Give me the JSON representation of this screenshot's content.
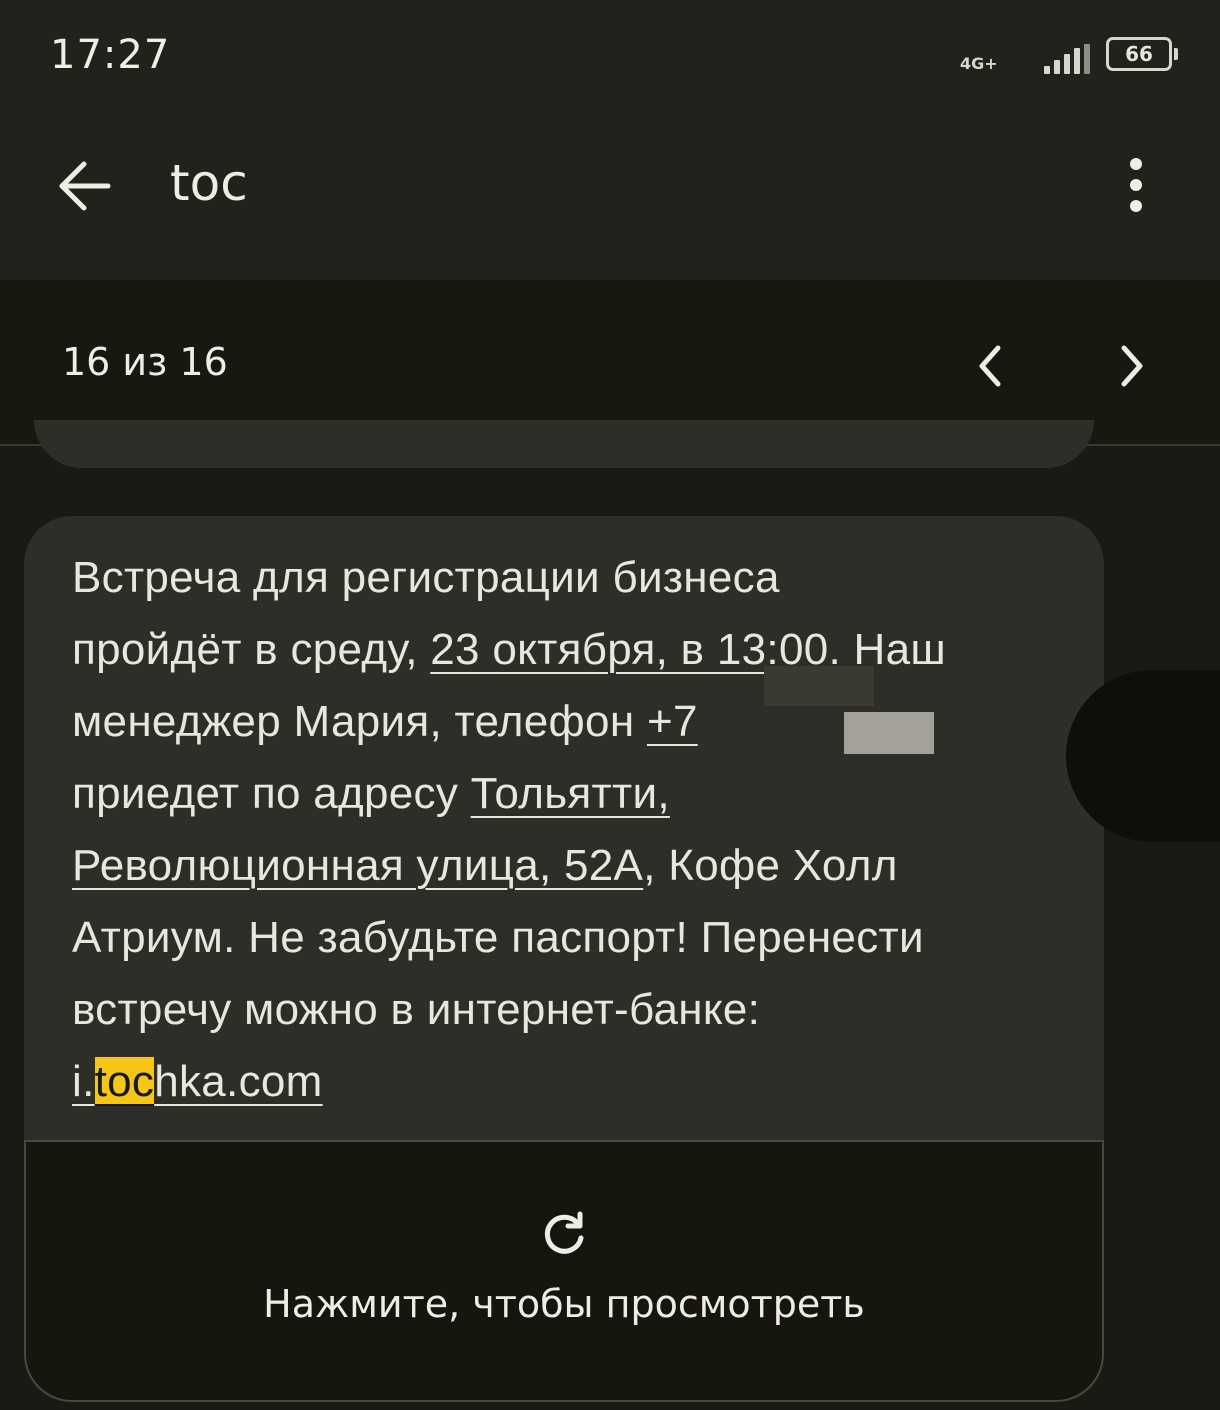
{
  "status_bar": {
    "time": "17:27",
    "network": "4G+",
    "battery": "66"
  },
  "app_bar": {
    "search_query": "toc",
    "back_icon": "arrow-back-icon",
    "more_icon": "more-vert-icon"
  },
  "search_results": {
    "count_text": "16 из 16",
    "prev_icon": "chevron-left-icon",
    "next_icon": "chevron-right-icon"
  },
  "message": {
    "line1": "Встреча для регистрации бизнеса",
    "line2_pre": "пройдёт в среду, ",
    "line2_link": "23 октября, в 13:00",
    "line2_post": ". Наш",
    "line3_pre": "менеджер Мария, телефон ",
    "line3_link": "+7",
    "line4_pre": "приедет по адресу ",
    "line4_link": "Тольятти,",
    "line5_link": "Революционная улица, 52А",
    "line5_post": ", Кофе Холл",
    "line6": "Атриум. Не забудьте паспорт! Перенести",
    "line7": "встречу можно в интернет-банке:",
    "url_pre": "i.",
    "url_highlight": "toc",
    "url_post": "hka.com"
  },
  "preview": {
    "label": "Нажмите, чтобы просмотреть",
    "icon": "refresh-icon"
  },
  "colors": {
    "highlight": "#f5c518",
    "bubble": "#2e2e28",
    "background": "#1a1a14"
  }
}
